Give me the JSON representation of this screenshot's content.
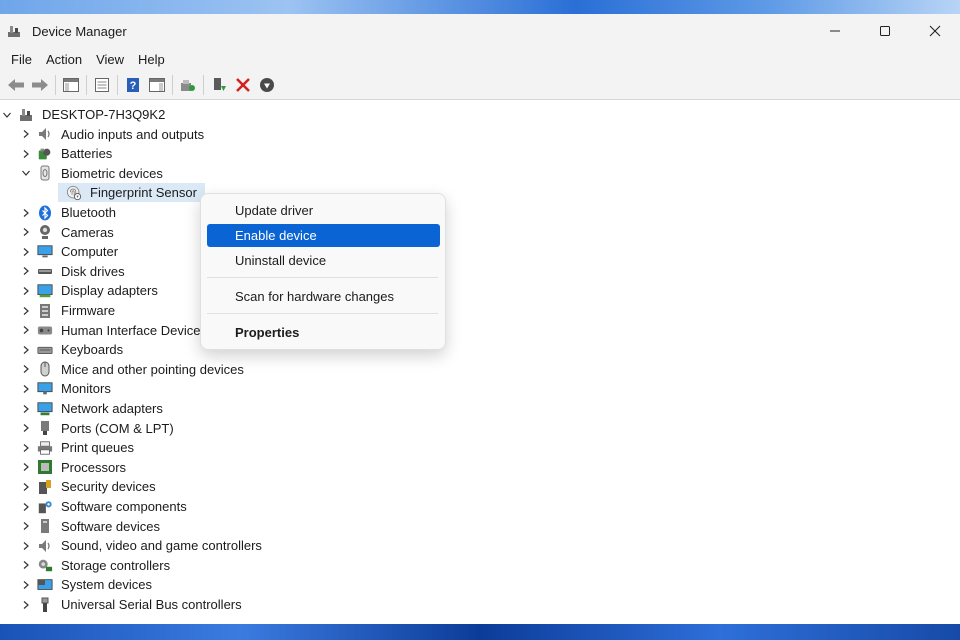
{
  "window": {
    "title": "Device Manager"
  },
  "menu": [
    "File",
    "Action",
    "View",
    "Help"
  ],
  "toolbar": {
    "icons": [
      "back-icon",
      "forward-icon",
      "show-hide-console-tree-icon",
      "properties-icon",
      "help-icon",
      "show-action-pane-icon",
      "scan-hardware-icon",
      "update-driver-icon",
      "uninstall-device-icon",
      "enable-device-icon"
    ]
  },
  "tree": {
    "root": "DESKTOP-7H3Q9K2",
    "categories": [
      {
        "label": "Audio inputs and outputs",
        "icon": "speaker-icon",
        "expanded": false
      },
      {
        "label": "Batteries",
        "icon": "battery-icon",
        "expanded": false
      },
      {
        "label": "Biometric devices",
        "icon": "biometric-icon",
        "expanded": true,
        "children": [
          "Fingerprint Sensor"
        ]
      },
      {
        "label": "Bluetooth",
        "icon": "bluetooth-icon",
        "expanded": false
      },
      {
        "label": "Cameras",
        "icon": "camera-icon",
        "expanded": false
      },
      {
        "label": "Computer",
        "icon": "computer-icon",
        "expanded": false
      },
      {
        "label": "Disk drives",
        "icon": "disk-drive-icon",
        "expanded": false
      },
      {
        "label": "Display adapters",
        "icon": "display-adapter-icon",
        "expanded": false
      },
      {
        "label": "Firmware",
        "icon": "firmware-icon",
        "expanded": false
      },
      {
        "label": "Human Interface Devices",
        "icon": "hid-icon",
        "expanded": false
      },
      {
        "label": "Keyboards",
        "icon": "keyboard-icon",
        "expanded": false
      },
      {
        "label": "Mice and other pointing devices",
        "icon": "mouse-icon",
        "expanded": false
      },
      {
        "label": "Monitors",
        "icon": "monitor-icon",
        "expanded": false
      },
      {
        "label": "Network adapters",
        "icon": "network-adapter-icon",
        "expanded": false
      },
      {
        "label": "Ports (COM & LPT)",
        "icon": "port-icon",
        "expanded": false
      },
      {
        "label": "Print queues",
        "icon": "printer-icon",
        "expanded": false
      },
      {
        "label": "Processors",
        "icon": "processor-icon",
        "expanded": false
      },
      {
        "label": "Security devices",
        "icon": "security-device-icon",
        "expanded": false
      },
      {
        "label": "Software components",
        "icon": "software-component-icon",
        "expanded": false
      },
      {
        "label": "Software devices",
        "icon": "software-device-icon",
        "expanded": false
      },
      {
        "label": "Sound, video and game controllers",
        "icon": "sound-icon",
        "expanded": false
      },
      {
        "label": "Storage controllers",
        "icon": "storage-controller-icon",
        "expanded": false
      },
      {
        "label": "System devices",
        "icon": "system-device-icon",
        "expanded": false
      },
      {
        "label": "Universal Serial Bus controllers",
        "icon": "usb-icon",
        "expanded": false
      }
    ]
  },
  "context_menu": {
    "items": [
      {
        "label": "Update driver",
        "highlighted": false,
        "bold": false
      },
      {
        "label": "Enable device",
        "highlighted": true,
        "bold": false
      },
      {
        "label": "Uninstall device",
        "highlighted": false,
        "bold": false
      },
      {
        "label": "Scan for hardware changes",
        "highlighted": false,
        "bold": false
      },
      {
        "label": "Properties",
        "highlighted": false,
        "bold": true
      }
    ]
  },
  "colors": {
    "highlight": "#0a64d3",
    "selection": "#dbe9f7",
    "delete_red": "#d42020"
  }
}
